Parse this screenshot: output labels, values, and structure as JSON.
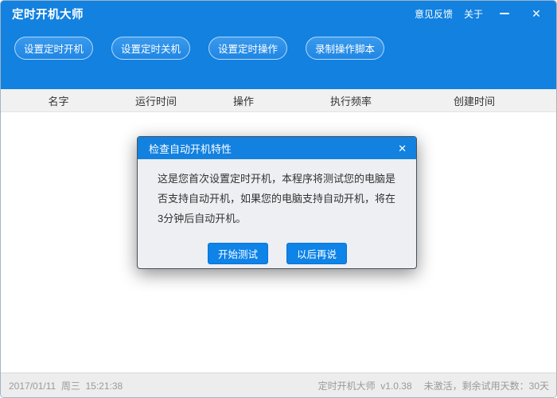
{
  "window": {
    "title": "定时开机大师",
    "menu": {
      "feedback": "意见反馈",
      "about": "关于"
    }
  },
  "toolbar": {
    "buttons": [
      {
        "label": "设置定时开机"
      },
      {
        "label": "设置定时关机"
      },
      {
        "label": "设置定时操作"
      },
      {
        "label": "录制操作脚本"
      }
    ]
  },
  "table": {
    "columns": [
      "名字",
      "运行时间",
      "操作",
      "执行频率",
      "创建时间"
    ],
    "rows": []
  },
  "dialog": {
    "title": "检查自动开机特性",
    "close_icon": "✕",
    "body": "这是您首次设置定时开机，本程序将测试您的电脑是否支持自动开机，如果您的电脑支持自动开机，将在3分钟后自动开机。",
    "buttons": {
      "start": "开始测试",
      "later": "以后再说"
    }
  },
  "statusbar": {
    "datetime": "2017/01/11  周三  15:21:38",
    "app_version": "定时开机大师  v1.0.38",
    "activation": "未激活，剩余试用天数：30天"
  },
  "icons": {
    "close": "✕"
  },
  "colors": {
    "primary_blue": "#1281e0",
    "toolbar_button_blue": "#2b90e8",
    "dialog_button_blue": "#0e83e8",
    "header_bg": "#f1f1f1",
    "statusbar_bg": "#ededed",
    "dialog_body_bg": "#edeff2"
  }
}
